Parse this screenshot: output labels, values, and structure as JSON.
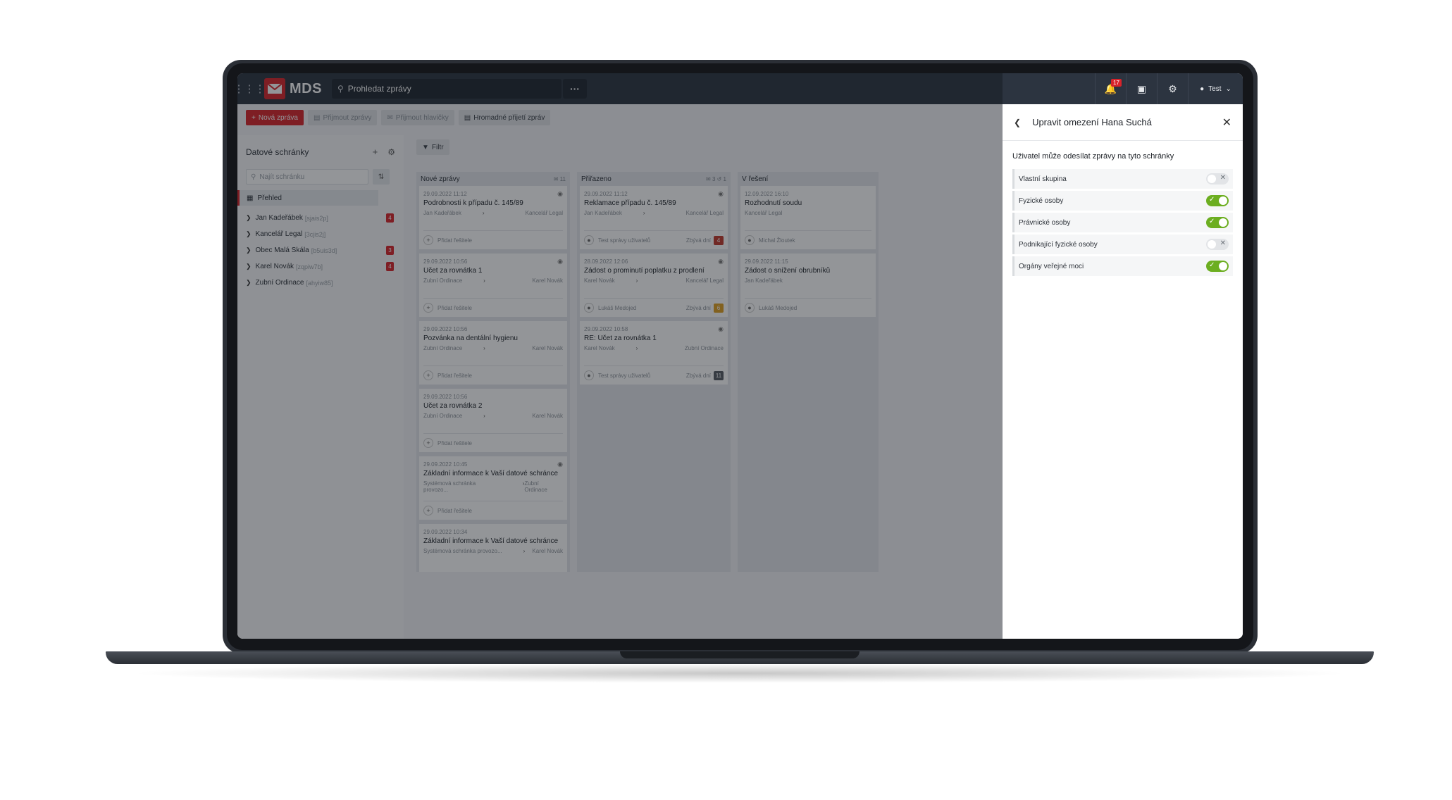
{
  "topbar": {
    "logo_text": "MDS",
    "search_placeholder": "Prohledat zprávy",
    "more": "···",
    "notifications_count": "17",
    "user_name": "Test"
  },
  "toolbar": {
    "new_message": "Nová zpráva",
    "receive_messages": "Přijmout zprávy",
    "receive_headers": "Přijmout hlavičky",
    "bulk_receive": "Hromadné přijetí zpráv"
  },
  "sidebar": {
    "title": "Datové schránky",
    "search_placeholder": "Najít schránku",
    "overview": "Přehled",
    "items": [
      {
        "name": "Jan Kadeřábek",
        "code": "[sjais2p]",
        "badge": "4"
      },
      {
        "name": "Kancelář Legal",
        "code": "[3cjis2j]",
        "badge": ""
      },
      {
        "name": "Obec Malá Skála",
        "code": "[b5uis3d]",
        "badge": "3"
      },
      {
        "name": "Karel Novák",
        "code": "[zqpiw7b]",
        "badge": "4"
      },
      {
        "name": "Zubní Ordinace",
        "code": "[ahyiw85]",
        "badge": ""
      }
    ]
  },
  "filter_label": "Filtr",
  "columns": [
    {
      "title": "Nové zprávy",
      "meta": "✉ 11",
      "cards": [
        {
          "date": "29.09.2022 11:12",
          "title": "Podrobnosti k případu č. 145/89",
          "from": "Jan Kadeřábek",
          "to": "Kancelář Legal",
          "foot": "Přidat řešitele",
          "days": "",
          "days_badge": ""
        },
        {
          "date": "29.09.2022 10:56",
          "title": "Účet za rovnátka 1",
          "from": "Zubní Ordinace",
          "to": "Karel Novák",
          "foot": "Přidat řešitele",
          "days": "",
          "days_badge": ""
        },
        {
          "date": "29.09.2022 10:56",
          "title": "Pozvánka na dentální hygienu",
          "from": "Zubní Ordinace",
          "to": "Karel Novák",
          "foot": "Přidat řešitele",
          "days": "",
          "days_badge": ""
        },
        {
          "date": "29.09.2022 10:56",
          "title": "Účet za rovnátka 2",
          "from": "Zubní Ordinace",
          "to": "Karel Novák",
          "foot": "Přidat řešitele",
          "days": "",
          "days_badge": ""
        },
        {
          "date": "29.09.2022 10:45",
          "title": "Základní informace k Vaší datové schránce",
          "from": "Systémová schránka provozo...",
          "to": "Zubní Ordinace",
          "foot": "Přidat řešitele",
          "days": "",
          "days_badge": ""
        },
        {
          "date": "29.09.2022 10:34",
          "title": "Základní informace k Vaší datové schránce",
          "from": "Systémová schránka provozo...",
          "to": "Karel Novák",
          "foot": "",
          "days": "",
          "days_badge": ""
        }
      ]
    },
    {
      "title": "Přiřazeno",
      "meta": "✉ 3  ↺ 1",
      "cards": [
        {
          "date": "29.09.2022 11:12",
          "title": "Reklamace případu č. 145/89",
          "from": "Jan Kadeřábek",
          "to": "Kancelář Legal",
          "foot": "Test správy uživatelů",
          "days": "Zbývá dní",
          "days_badge": "4"
        },
        {
          "date": "28.09.2022 12:06",
          "title": "Žádost o prominutí poplatku z prodlení",
          "from": "Karel Novák",
          "to": "Kancelář Legal",
          "foot": "Lukáš Medojed",
          "days": "Zbývá dní",
          "days_badge": "6"
        },
        {
          "date": "29.09.2022 10:58",
          "title": "RE: Účet za rovnátka 1",
          "from": "Karel Novák",
          "to": "Zubní Ordinace",
          "foot": "Test správy uživatelů",
          "days": "Zbývá dní",
          "days_badge": "11"
        }
      ]
    },
    {
      "title": "V řešení",
      "meta": "",
      "cards": [
        {
          "date": "12.09.2022 16:10",
          "title": "Rozhodnutí soudu",
          "from": "Kancelář Legal",
          "to": "",
          "foot": "Michal Žloutek",
          "days": "",
          "days_badge": ""
        },
        {
          "date": "29.09.2022 11:15",
          "title": "Žádost o snížení obrubníků",
          "from": "Jan Kadeřábek",
          "to": "",
          "foot": "Lukáš Medojed",
          "days": "",
          "days_badge": ""
        }
      ]
    }
  ],
  "panel": {
    "title": "Upravit omezení Hana Suchá",
    "subtitle": "Uživatel může odesílat zprávy na tyto schránky",
    "permissions": [
      {
        "label": "Vlastní skupina",
        "enabled": false
      },
      {
        "label": "Fyzické osoby",
        "enabled": true
      },
      {
        "label": "Právnické osoby",
        "enabled": true
      },
      {
        "label": "Podnikající fyzické osoby",
        "enabled": false
      },
      {
        "label": "Orgány veřejné moci",
        "enabled": true
      }
    ]
  },
  "colors": {
    "brand": "#d8232a",
    "topbar": "#2c3440",
    "toggle_on": "#6cae20",
    "days_badge_red": "#c0392b",
    "days_badge_orange": "#e0a020",
    "days_badge_gray": "#555b63"
  }
}
